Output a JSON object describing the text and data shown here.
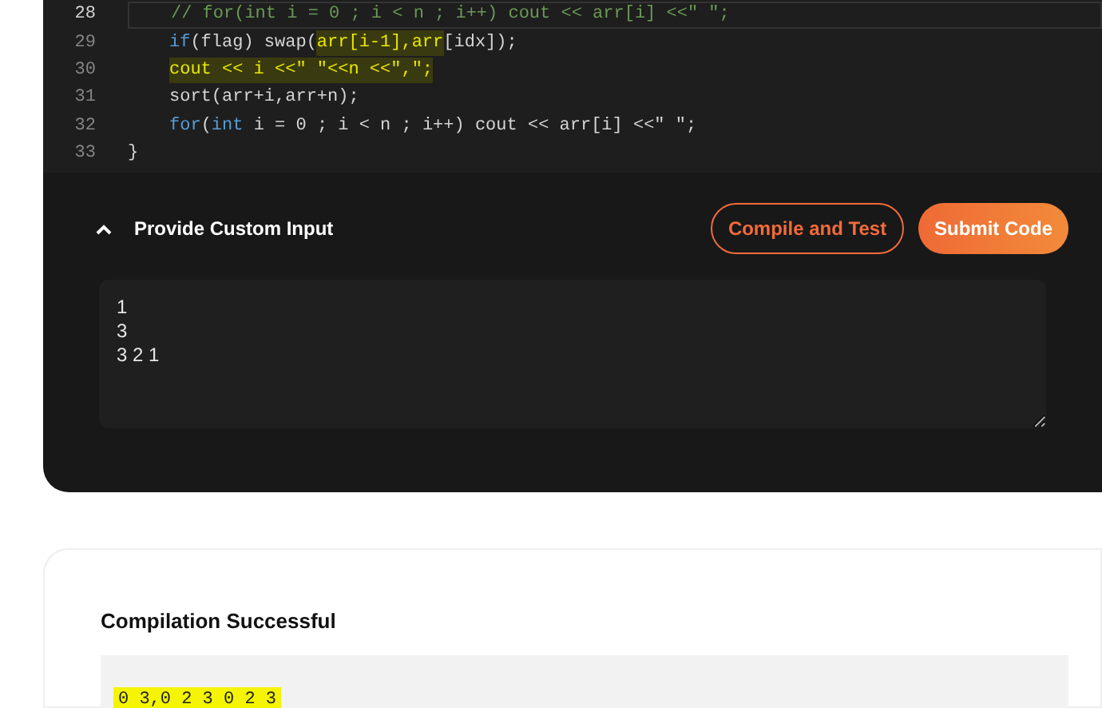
{
  "editor": {
    "lines": [
      {
        "number": "28",
        "current": true,
        "indented": true,
        "tokens": [
          {
            "text": "// for(int i = 0 ; i < n ; i++) cout << arr[i] <<\" \";",
            "kind": "comment"
          }
        ]
      },
      {
        "number": "29",
        "current": false,
        "indented": true,
        "tokens": [
          {
            "text": "if",
            "kind": "keyword"
          },
          {
            "text": "(flag) swap(",
            "kind": "plain"
          },
          {
            "text": "arr[i-1],arr",
            "kind": "highlight"
          },
          {
            "text": "[idx]);",
            "kind": "plain"
          }
        ]
      },
      {
        "number": "30",
        "current": false,
        "indented": true,
        "tokens": [
          {
            "text": "cout << i <<\" \"<<n <<\",\";",
            "kind": "highlight"
          }
        ]
      },
      {
        "number": "31",
        "current": false,
        "indented": true,
        "tokens": [
          {
            "text": "sort(arr+i,arr+n);",
            "kind": "plain"
          }
        ]
      },
      {
        "number": "32",
        "current": false,
        "indented": true,
        "tokens": [
          {
            "text": "for",
            "kind": "keyword"
          },
          {
            "text": "(",
            "kind": "plain"
          },
          {
            "text": "int",
            "kind": "keyword"
          },
          {
            "text": " i = 0 ; i < n ; i++) cout << arr[i] <<\" \";",
            "kind": "plain"
          }
        ]
      },
      {
        "number": "33",
        "current": false,
        "indented": false,
        "tokens": [
          {
            "text": "}",
            "kind": "plain"
          }
        ]
      }
    ]
  },
  "custom_input": {
    "title": "Provide Custom Input",
    "expanded": true,
    "value": "1\n3\n3 2 1"
  },
  "buttons": [
    {
      "label": "Compile and Test",
      "kind": "outline"
    },
    {
      "label": "Submit Code",
      "kind": "filled"
    }
  ],
  "result": {
    "title": "Compilation Successful",
    "output": "0 3,0 2 3 0 2 3",
    "highlighted": true
  }
}
